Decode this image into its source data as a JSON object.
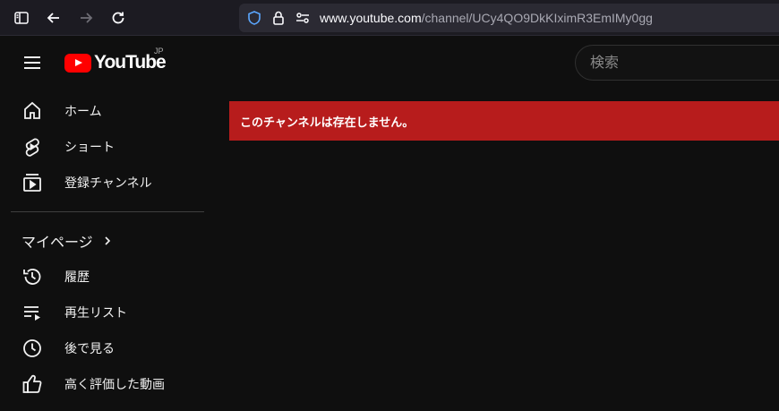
{
  "browser": {
    "url_host": "www.youtube.com",
    "url_path": "/channel/UCy4QO9DkKIximR3EmIMy0gg"
  },
  "header": {
    "logo_text": "YouTube",
    "region": "JP",
    "search_placeholder": "検索"
  },
  "sidebar": {
    "main_items": [
      {
        "label": "ホーム",
        "icon": "home-icon"
      },
      {
        "label": "ショート",
        "icon": "shorts-icon"
      },
      {
        "label": "登録チャンネル",
        "icon": "subscriptions-icon"
      }
    ],
    "section_title": "マイページ",
    "section_items": [
      {
        "label": "履歴",
        "icon": "history-icon"
      },
      {
        "label": "再生リスト",
        "icon": "playlist-icon"
      },
      {
        "label": "後で見る",
        "icon": "watch-later-icon"
      },
      {
        "label": "高く評価した動画",
        "icon": "liked-videos-icon"
      }
    ]
  },
  "alert": {
    "message": "このチャンネルは存在しません。"
  },
  "colors": {
    "background": "#0f0f0f",
    "alert_red": "#b71c1c",
    "brand_red": "#ff0000"
  }
}
